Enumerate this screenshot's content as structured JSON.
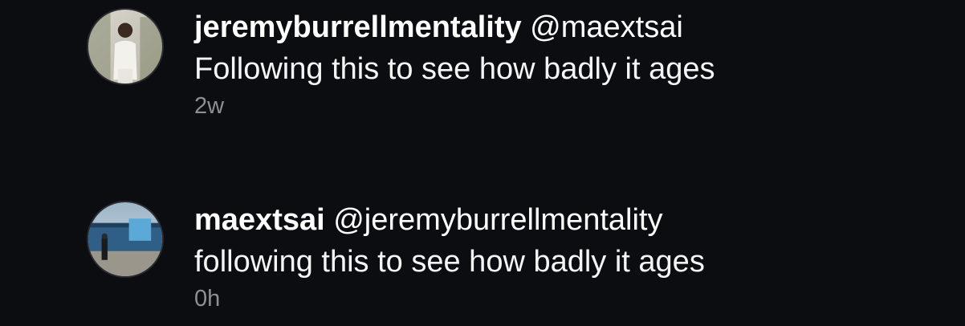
{
  "comments": [
    {
      "username": "jeremyburrellmentality",
      "mention": "@maextsai",
      "text": "Following this to see how badly it ages",
      "time": "2w",
      "avatar_icon": "profile-photo-person-white-shirt"
    },
    {
      "username": "maextsai",
      "mention": "@jeremyburrellmentality",
      "text": "following this to see how badly it ages",
      "time": "0h",
      "avatar_icon": "profile-photo-stadium"
    }
  ],
  "colors": {
    "background": "#0c0d11",
    "text": "#ffffff",
    "timestamp": "#8e8e93"
  }
}
